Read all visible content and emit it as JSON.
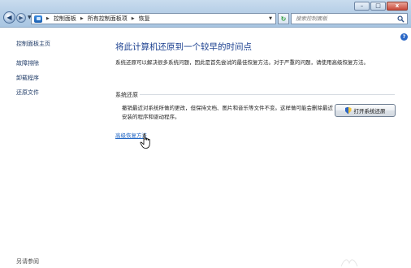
{
  "address_bar": {
    "breadcrumbs": [
      "控制面板",
      "所有控制面板项",
      "恢复"
    ],
    "search_placeholder": "搜索控制面板"
  },
  "window_controls": {
    "minimize": "–",
    "maximize": "□",
    "close": "x"
  },
  "left_pane": {
    "home": "控制面板主页",
    "links": [
      "故障排除",
      "卸载程序",
      "还原文件"
    ],
    "see_also": "另请参阅"
  },
  "main": {
    "heading": "将此计算机还原到一个较早的时间点",
    "description": "系统还原可以解决很多系统问题，因此是首先尝试的最佳恢复方法。对于严重的问题，请使用高级恢复方法。",
    "section_title": "系统还原",
    "section_text": "撤销最近对系统所做的更改，但保持文档、图片和音乐等文件不变。这样做可能会删除最近安装的程序和驱动程序。",
    "open_button": "打开系统还原",
    "advanced_link": "高级恢复方法",
    "help": "?"
  },
  "icons": {
    "back": "back-arrow-icon",
    "forward": "forward-arrow-icon",
    "refresh": "refresh-icon",
    "search": "search-icon",
    "shield": "uac-shield-icon",
    "cursor": "hand-cursor-icon"
  },
  "colors": {
    "heading": "#1a3f8f",
    "link": "#2166c4",
    "titlebar": "#b7cfe7"
  }
}
